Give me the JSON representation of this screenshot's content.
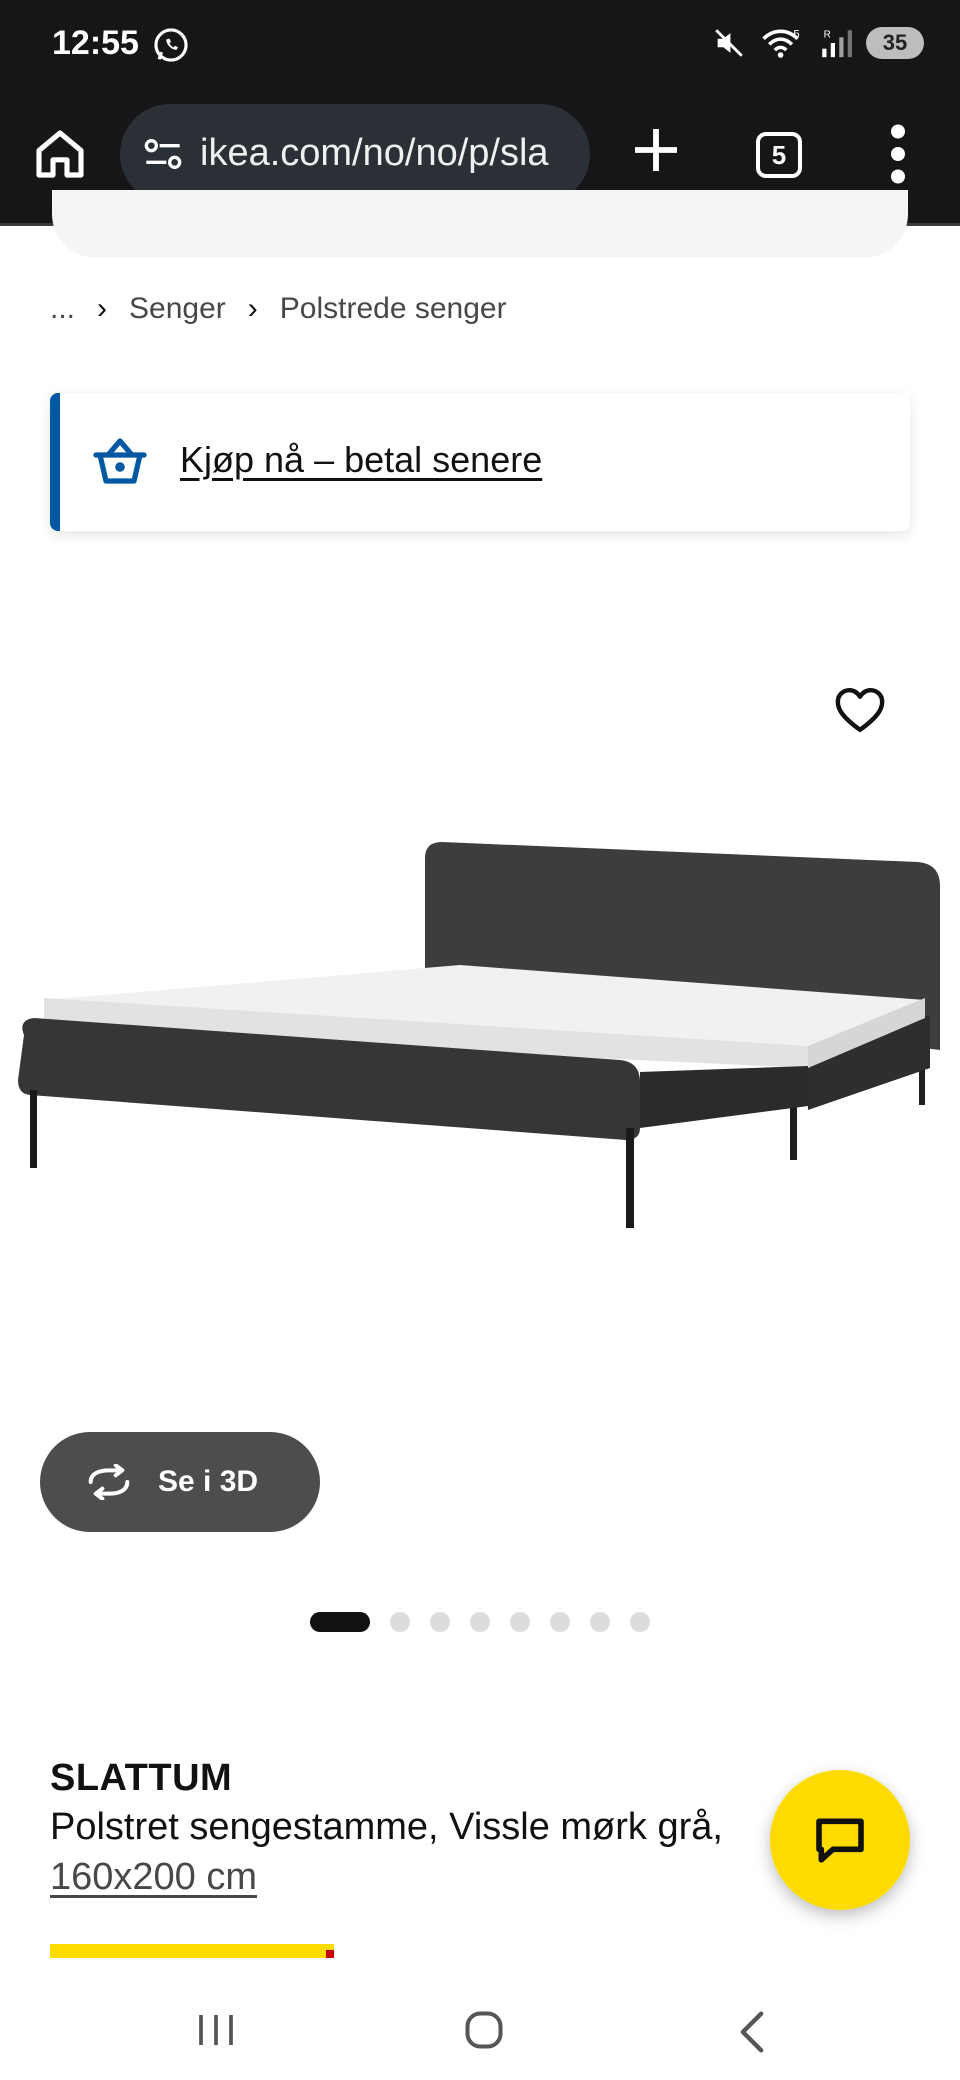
{
  "status_bar": {
    "time": "12:55",
    "battery": "35",
    "network_labels": [
      "5",
      "R"
    ]
  },
  "browser": {
    "url": "ikea.com/no/no/p/sla",
    "tab_count": "5"
  },
  "breadcrumb": {
    "items": [
      "...",
      "Senger",
      "Polstrede senger"
    ]
  },
  "promo": {
    "text": "Kjøp nå – betal senere"
  },
  "gallery": {
    "view_3d_label": "Se i 3D",
    "image_count": 8,
    "active_index": 0
  },
  "product": {
    "name": "SLATTUM",
    "description": "Polstret sengestamme, Vissle mørk grå,",
    "size": "160x200 cm"
  },
  "colors": {
    "browser_chrome": "#161618",
    "url_pill": "#2b2f36",
    "accent_blue": "#0058a3",
    "ikea_yellow": "#ffdb00",
    "ikea_red": "#cc0008",
    "view3d_bg": "#4d4d4d"
  },
  "icons": {
    "home": "home-icon",
    "site_settings": "tune-icon",
    "new_tab": "plus-icon",
    "menu": "more-vert-icon",
    "wishlist": "heart-icon",
    "rotate_3d": "rotate-icon",
    "chat": "chat-icon",
    "basket": "basket-icon"
  }
}
